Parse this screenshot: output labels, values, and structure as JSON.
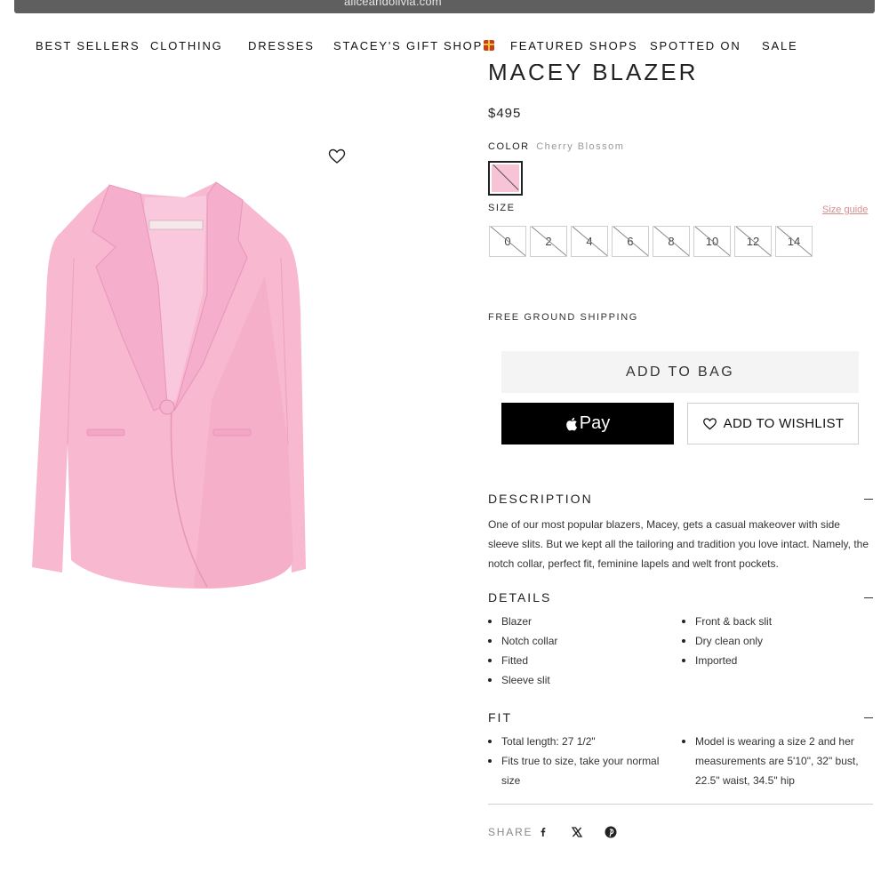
{
  "browser": {
    "url": "aliceandolivia.com"
  },
  "nav": {
    "items": [
      {
        "label": "BEST SELLERS"
      },
      {
        "label": "CLOTHING"
      },
      {
        "label": "DRESSES"
      },
      {
        "label": "STACEY'S GIFT SHOP"
      },
      {
        "label": "FEATURED SHOPS"
      },
      {
        "label": "SPOTTED ON"
      },
      {
        "label": "SALE"
      }
    ]
  },
  "product": {
    "title": "MACEY BLAZER",
    "price": "$495",
    "color_label": "COLOR",
    "color_value": "Cherry Blossom",
    "swatch_color": "#f8c3d6",
    "size_label": "SIZE",
    "size_guide": "Size guide",
    "sizes": [
      "0",
      "2",
      "4",
      "6",
      "8",
      "10",
      "12",
      "14"
    ],
    "shipping": "FREE GROUND SHIPPING",
    "add_to_bag": "ADD TO BAG",
    "apple_pay": "Pay",
    "add_to_wishlist": "ADD TO WISHLIST",
    "image_color": "#f7b8d0"
  },
  "description": {
    "heading": "DESCRIPTION",
    "text": "One of our most popular blazers, Macey, gets a casual makeover with side sleeve slits. But we kept all the tailoring and tradition you love intact. Namely, the notch collar, perfect fit, feminine lapels and welt front pockets."
  },
  "details": {
    "heading": "DETAILS",
    "left": [
      "Blazer",
      "Notch collar",
      "Fitted",
      "Sleeve slit"
    ],
    "right": [
      "Front & back slit",
      "Dry clean only",
      "Imported"
    ]
  },
  "fit": {
    "heading": "FIT",
    "left": [
      "Total length: 27 1/2\"",
      "Fits true to size, take your normal size"
    ],
    "right": [
      "Model is wearing a size 2 and her measurements are 5'10\", 32\" bust, 22.5\" waist, 34.5\" hip"
    ]
  },
  "share": {
    "label": "SHARE",
    "icons": [
      "facebook-icon",
      "x-icon",
      "pinterest-icon"
    ]
  }
}
